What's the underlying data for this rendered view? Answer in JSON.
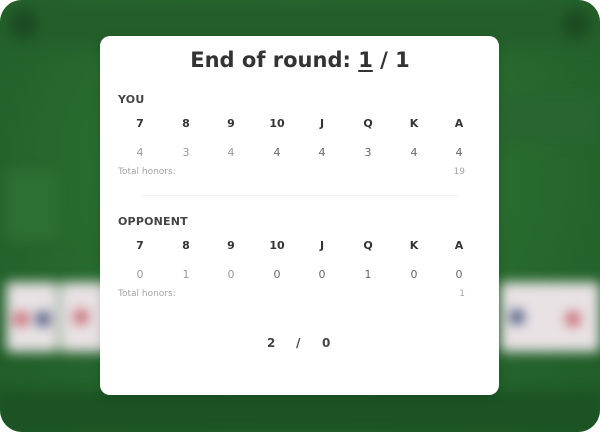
{
  "modal": {
    "title_prefix": "End of round: ",
    "round_current": "1",
    "round_sep": " / ",
    "round_total": "1"
  },
  "card_ranks": [
    "7",
    "8",
    "9",
    "10",
    "J",
    "Q",
    "K",
    "A"
  ],
  "you": {
    "label": "YOU",
    "values": [
      "4",
      "3",
      "4",
      "4",
      "4",
      "3",
      "4",
      "4"
    ],
    "total_label": "Total honors:",
    "total_value": "19"
  },
  "opponent": {
    "label": "OPPONENT",
    "values": [
      "0",
      "1",
      "0",
      "0",
      "0",
      "1",
      "0",
      "0"
    ],
    "total_label": "Total honors:",
    "total_value": "1"
  },
  "score": {
    "you": "2",
    "sep": "/",
    "opponent": "0"
  },
  "colors": {
    "table_green": "#2f7a36",
    "modal_bg": "#ffffff",
    "text_dark": "#333333",
    "text_muted": "#9a9a9a"
  }
}
